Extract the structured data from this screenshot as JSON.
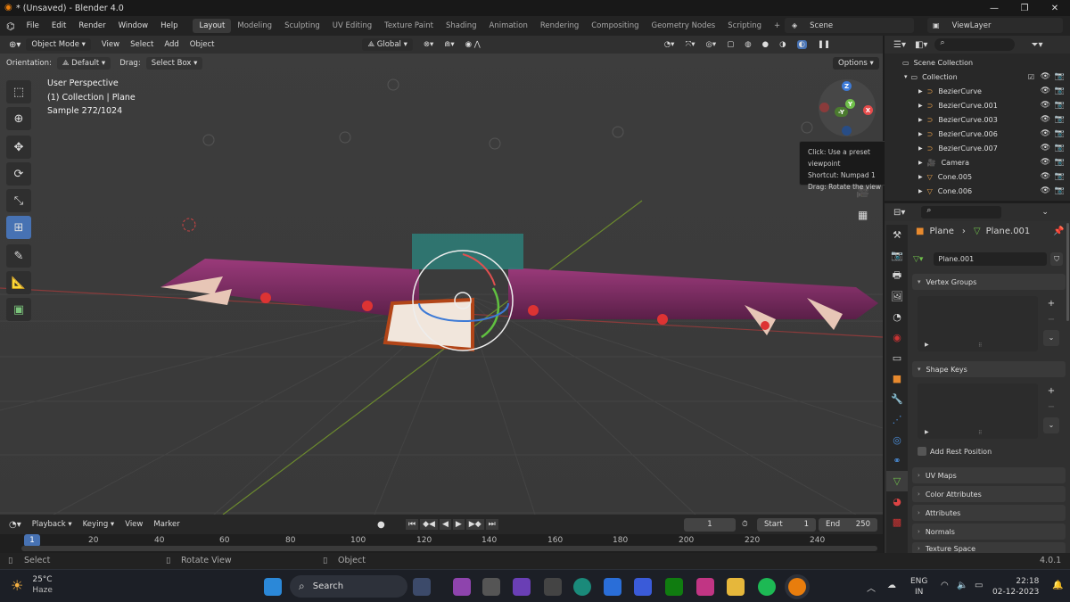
{
  "window": {
    "title": "* (Unsaved) - Blender 4.0",
    "minimize": "—",
    "maximize": "❐",
    "close": "✕"
  },
  "menu": {
    "items": [
      "File",
      "Edit",
      "Render",
      "Window",
      "Help"
    ]
  },
  "workspaces": [
    "Layout",
    "Modeling",
    "Sculpting",
    "UV Editing",
    "Texture Paint",
    "Shading",
    "Animation",
    "Rendering",
    "Compositing",
    "Geometry Nodes",
    "Scripting"
  ],
  "scene": {
    "name": "Scene",
    "view_layer": "ViewLayer"
  },
  "viewport_header": {
    "mode": "Object Mode",
    "view": "View",
    "select": "Select",
    "add": "Add",
    "object": "Object",
    "transform": "Global",
    "options": "Options"
  },
  "tool_settings": {
    "orientation_label": "Orientation:",
    "orientation_value": "Default",
    "drag_label": "Drag:",
    "drag_value": "Select Box"
  },
  "viewport_info": {
    "line1": "User Perspective",
    "line2": "(1) Collection | Plane",
    "line3": "Sample 272/1024"
  },
  "tooltip": {
    "line1": "Click: Use a preset viewpoint",
    "line2": "Shortcut: Numpad 1",
    "line3": "Drag: Rotate the view"
  },
  "gizmo": {
    "z": "Z",
    "y": "Y",
    "x": "X",
    "neg_y": "-Y"
  },
  "outliner": {
    "scene_collection": "Scene Collection",
    "collection": "Collection",
    "items": [
      "BezierCurve",
      "BezierCurve.001",
      "BezierCurve.003",
      "BezierCurve.006",
      "BezierCurve.007",
      "Camera",
      "Cone.005",
      "Cone.006"
    ]
  },
  "properties": {
    "object_name": "Plane",
    "data_name": "Plane.001",
    "mesh_field": "Plane.001",
    "sections": {
      "vertex_groups": "Vertex Groups",
      "shape_keys": "Shape Keys",
      "add_rest_position": "Add Rest Position",
      "uv_maps": "UV Maps",
      "color_attributes": "Color Attributes",
      "attributes": "Attributes",
      "normals": "Normals",
      "texture_space": "Texture Space"
    }
  },
  "timeline": {
    "playback": "Playback",
    "keying": "Keying",
    "view": "View",
    "marker": "Marker",
    "current_frame": "1",
    "start_label": "Start",
    "start": "1",
    "end_label": "End",
    "end": "250",
    "ticks": [
      "1",
      "20",
      "40",
      "60",
      "80",
      "100",
      "120",
      "140",
      "160",
      "180",
      "200",
      "220",
      "240"
    ]
  },
  "statusbar": {
    "select": "Select",
    "rotate": "Rotate View",
    "object": "Object",
    "version": "4.0.1"
  },
  "taskbar": {
    "temp": "25°C",
    "weather": "Haze",
    "search": "Search",
    "lang1": "ENG",
    "lang2": "IN",
    "time": "22:18",
    "date": "02-12-2023"
  },
  "colors": {
    "accent": "#4772b3",
    "viewport_bg": "#3c3c3c",
    "x_axis": "#e64c4c",
    "y_axis": "#6fbf4a",
    "z_axis": "#3d7ad6"
  }
}
